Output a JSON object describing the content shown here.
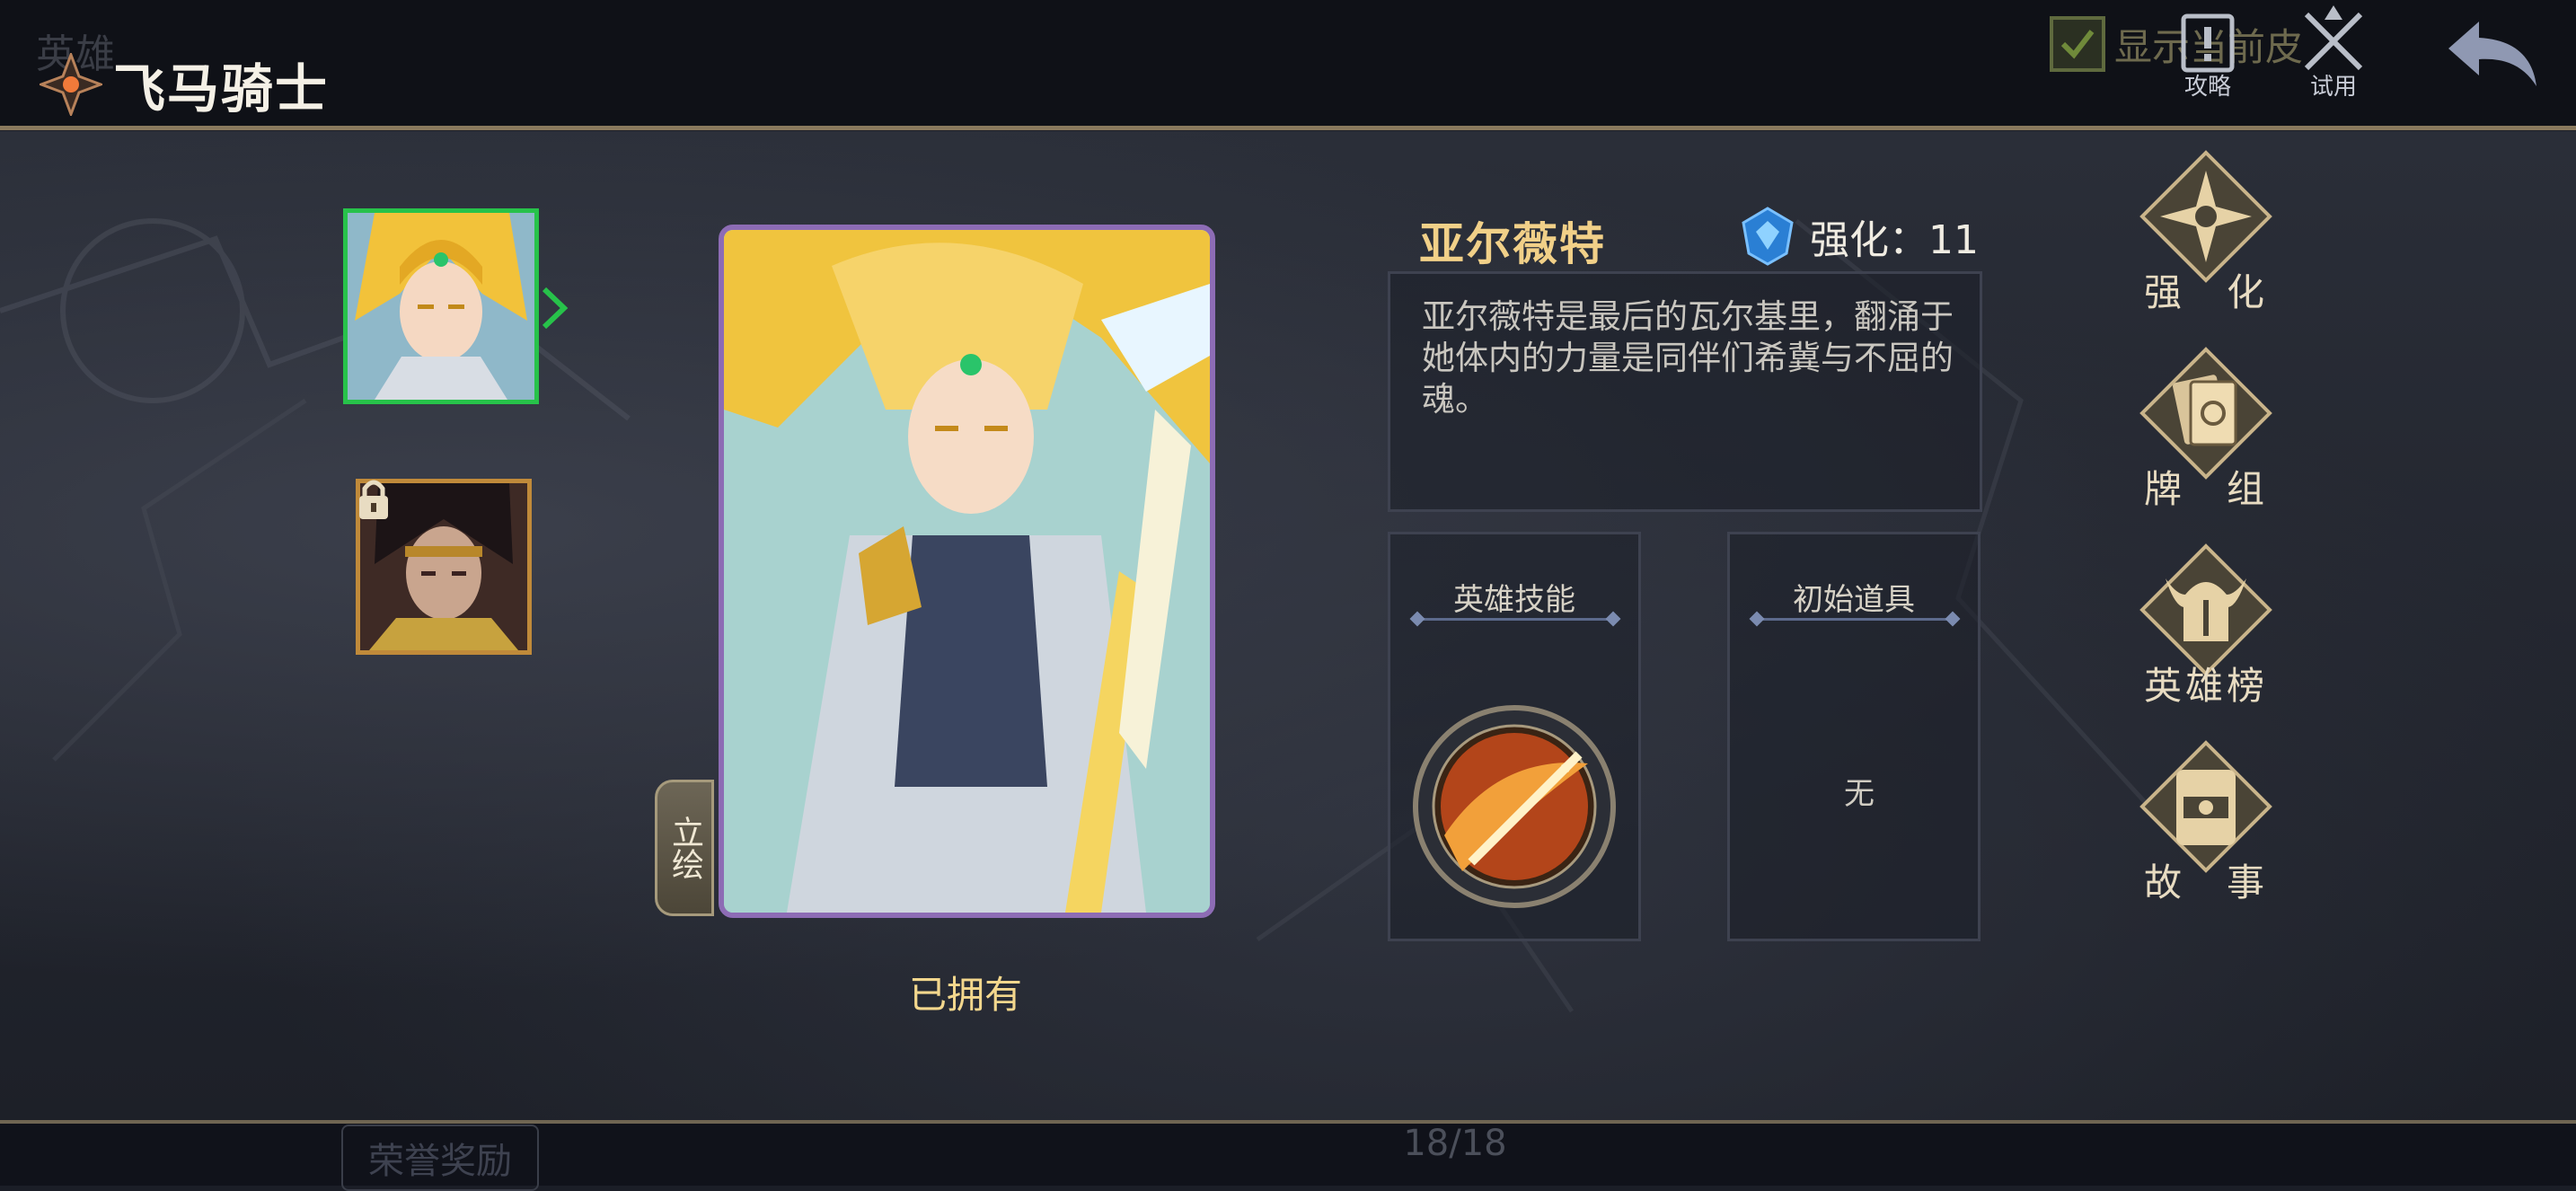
{
  "header": {
    "ghost_tab_left": "英雄",
    "title": "飞马骑士",
    "show_current_skin_label": "显示当前皮",
    "strategy_label": "攻略",
    "trial_label": "试用"
  },
  "heroes": [
    {
      "name": "hero-portrait-selected",
      "state": "selected"
    },
    {
      "name": "hero-portrait-locked",
      "state": "locked"
    }
  ],
  "card": {
    "art_tab_label": "立绘",
    "status": "已拥有"
  },
  "info": {
    "hero_name": "亚尔薇特",
    "enhance_label": "强化：11",
    "description": "亚尔薇特是最后的瓦尔基里，翻涌于她体内的力量是同伴们希冀与不屈的魂。",
    "skill_title": "英雄技能",
    "item_title": "初始道具",
    "item_value": "无"
  },
  "side_menu": {
    "enhance": "强　化",
    "deck": "牌　组",
    "ranking": "英雄榜",
    "story": "故　事"
  },
  "footer": {
    "honor_rewards": "荣誉奖励",
    "page_count": "18/18"
  },
  "colors": {
    "accent_gold": "#f1d088",
    "selected_border": "#27c24a",
    "card_border": "#8d6cb5",
    "locked_border": "#c08a3a"
  }
}
